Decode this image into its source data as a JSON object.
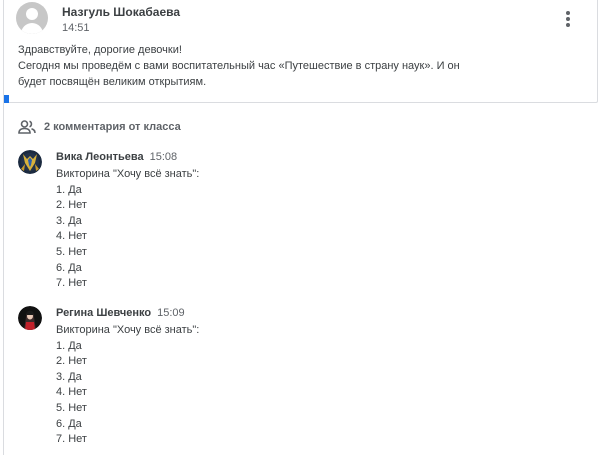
{
  "post": {
    "author": "Назгуль Шокабаева",
    "time": "14:51",
    "body_lines": [
      "Здравствуйте, дорогие девочки!",
      "Сегодня мы проведём с вами воспитательный час «Путешествие в страну наук». И он",
      "будет посвящён великим открытиям."
    ],
    "menu_icon": "more-vert-icon",
    "avatar_icon": "default-avatar-icon"
  },
  "comments_header": {
    "icon": "people-icon",
    "label": "2 комментария от класса"
  },
  "comments": [
    {
      "author": "Вика Леонтьева",
      "time": "15:08",
      "lines": [
        "Викторина \"Хочу всё знать\":",
        "1. Да",
        "2. Нет",
        "3. Да",
        "4. Нет",
        "5. Нет",
        "6. Да",
        "7. Нет"
      ]
    },
    {
      "author": "Регина Шевченко",
      "time": "15:09",
      "lines": [
        "Викторина \"Хочу всё знать\":",
        "1. Да",
        "2. Нет",
        "3. Да",
        "4. Нет",
        "5. Нет",
        "6. Да",
        "7. Нет"
      ]
    }
  ],
  "colors": {
    "accent": "#1a73e8",
    "divider": "#dadce0",
    "text_primary": "#3c4043",
    "text_secondary": "#5f6368"
  }
}
